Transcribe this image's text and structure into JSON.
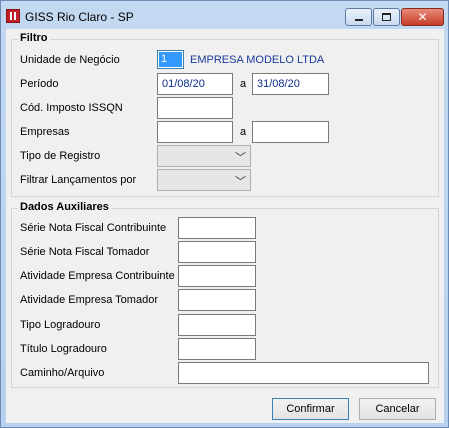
{
  "window": {
    "title": "GISS Rio Claro - SP"
  },
  "filtro": {
    "title": "Filtro",
    "unidade_label": "Unidade de Negócio",
    "unidade_code": "1",
    "unidade_name": "EMPRESA MODELO LTDA",
    "periodo_label": "Período",
    "periodo_from": "01/08/20",
    "periodo_sep": "a",
    "periodo_to": "31/08/20",
    "imposto_label": "Cód. Imposto ISSQN",
    "imposto_value": "",
    "empresas_label": "Empresas",
    "empresas_from": "",
    "empresas_sep": "a",
    "empresas_to": "",
    "tipo_registro_label": "Tipo de Registro",
    "tipo_registro_value": "",
    "filtrar_label": "Filtrar Lançamentos por",
    "filtrar_value": ""
  },
  "auxiliares": {
    "title": "Dados Auxiliares",
    "serie_contribuinte_label": "Série Nota Fiscal Contribuinte",
    "serie_tomador_label": "Série Nota Fiscal Tomador",
    "atividade_contribuinte_label": "Atividade Empresa Contribuinte",
    "atividade_tomador_label": "Atividade Empresa Tomador",
    "tipo_logradouro_label": "Tipo Logradouro",
    "titulo_logradouro_label": "Título Logradouro",
    "caminho_label": "Caminho/Arquivo"
  },
  "buttons": {
    "confirmar": "Confirmar",
    "cancelar": "Cancelar"
  },
  "colors": {
    "title_bar": "#b7d0ee",
    "close_button": "#c63d2a",
    "selection": "#3399ff",
    "company_text": "#1a3a9c"
  }
}
